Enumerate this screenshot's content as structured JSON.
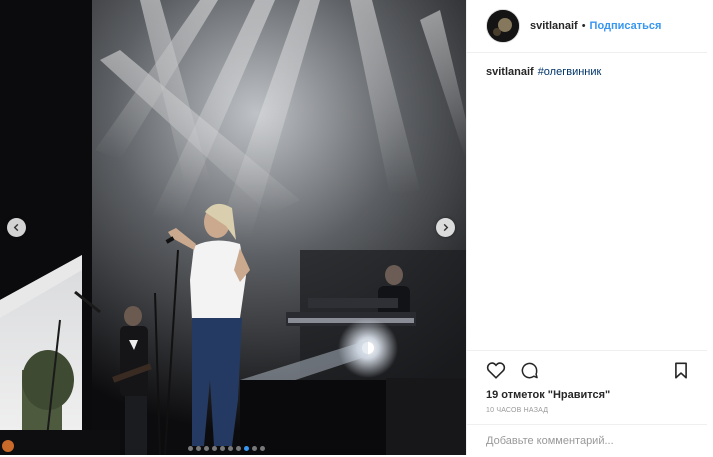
{
  "post": {
    "username": "svitlanaif",
    "separator": "•",
    "follow_label": "Подписаться",
    "caption": {
      "username": "svitlanaif",
      "hashtag": "#олегвинник"
    },
    "likes_text": "19 отметок \"Нравится\"",
    "timestamp": "10 ЧАСОВ НАЗАД",
    "comment_placeholder": "Добавьте комментарий...",
    "carousel": {
      "slide_count": 10,
      "active_slide": 7
    },
    "icons": {
      "prev": "chevron-left-icon",
      "next": "chevron-right-icon",
      "like": "heart-icon",
      "comment": "comment-icon",
      "save": "bookmark-icon"
    },
    "colors": {
      "link": "#3897f0",
      "hashtag": "#003569",
      "text": "#262626",
      "muted": "#999999"
    }
  }
}
